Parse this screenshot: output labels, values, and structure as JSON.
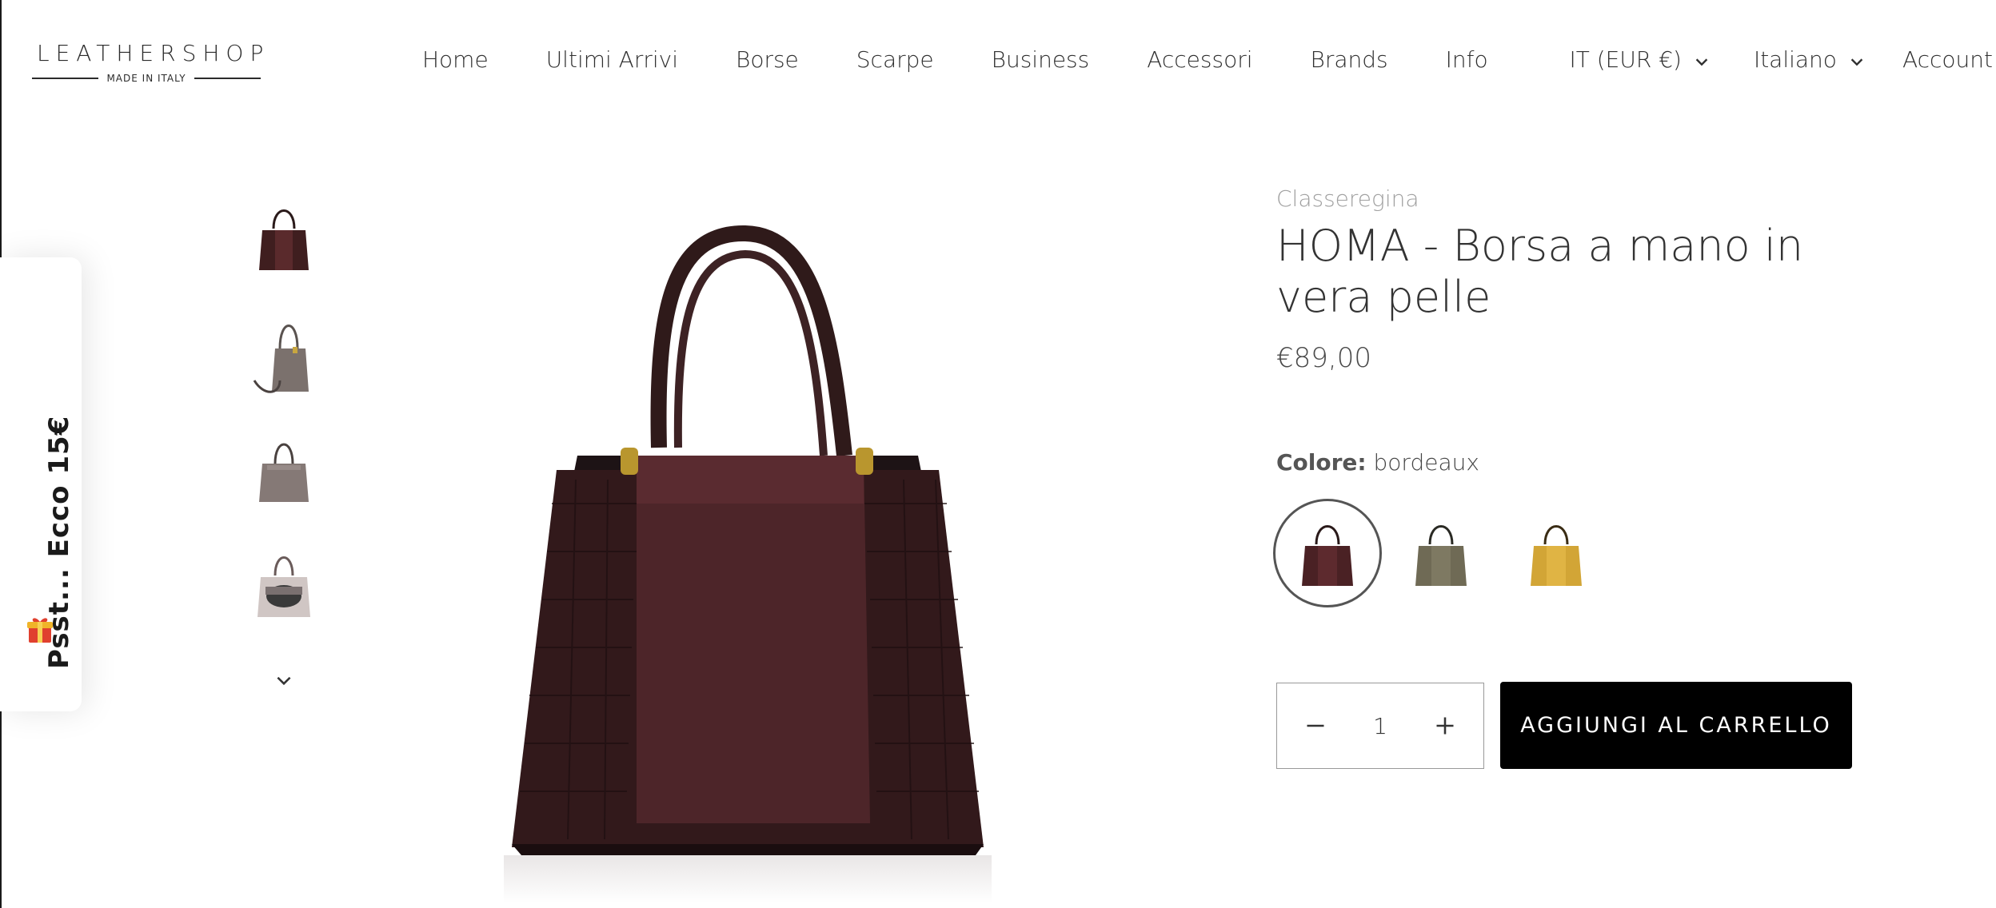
{
  "header": {
    "logo_text": "LEATHERSHOP",
    "logo_subtext": "MADE IN ITALY",
    "nav": [
      {
        "label": "Home"
      },
      {
        "label": "Ultimi Arrivi"
      },
      {
        "label": "Borse"
      },
      {
        "label": "Scarpe"
      },
      {
        "label": "Business"
      },
      {
        "label": "Accessori"
      },
      {
        "label": "Brands"
      },
      {
        "label": "Info"
      }
    ],
    "currency_selector": "IT (EUR €)",
    "language_selector": "Italiano",
    "account_label": "Account"
  },
  "promo_tab": {
    "text": "Psst... Ecco 15€",
    "icon": "gift-icon"
  },
  "gallery": {
    "thumbnails": [
      {
        "icon": "bag-front-burgundy"
      },
      {
        "icon": "bag-side-grey-strap"
      },
      {
        "icon": "bag-back-grey"
      },
      {
        "icon": "bag-open-interior"
      }
    ],
    "scroll_icon": "chevron-down-icon"
  },
  "product": {
    "brand": "Classeregina",
    "title": "HOMA - Borsa a mano in vera pelle",
    "price": "€89,00",
    "color_label": "Colore:",
    "color_value": "bordeaux",
    "swatches": [
      {
        "color": "#4a2124",
        "selected": true
      },
      {
        "color": "#6f6a55",
        "selected": false
      },
      {
        "color": "#d2a536",
        "selected": false
      }
    ],
    "quantity": "1",
    "add_to_cart_label": "AGGIUNGI AL CARRELLO"
  },
  "colors": {
    "text": "#333333",
    "brand_grey": "#a0a0a0",
    "button_bg": "#000000",
    "button_text": "#ffffff"
  }
}
